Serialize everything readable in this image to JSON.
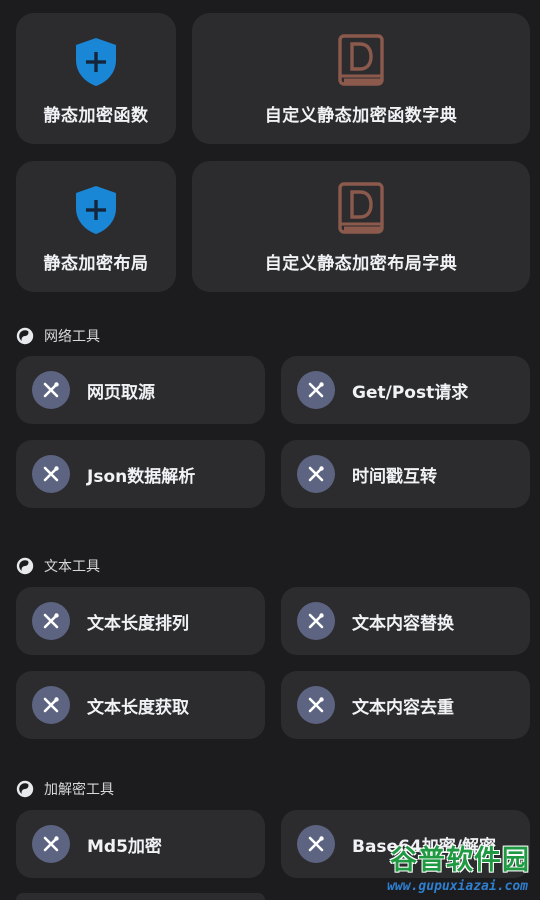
{
  "feature_cards": [
    {
      "label": "静态加密函数",
      "icon": "shield-plus-icon"
    },
    {
      "label": "自定义静态加密函数字典",
      "icon": "dictionary-book-icon"
    },
    {
      "label": "静态加密布局",
      "icon": "shield-plus-icon"
    },
    {
      "label": "自定义静态加密布局字典",
      "icon": "dictionary-book-icon"
    }
  ],
  "sections": [
    {
      "title": "网络工具",
      "tools": [
        {
          "label": "网页取源",
          "icon": "tools-icon"
        },
        {
          "label": "Get/Post请求",
          "icon": "tools-icon"
        },
        {
          "label": "Json数据解析",
          "icon": "tools-icon"
        },
        {
          "label": "时间戳互转",
          "icon": "tools-icon"
        }
      ]
    },
    {
      "title": "文本工具",
      "tools": [
        {
          "label": "文本长度排列",
          "icon": "tools-icon"
        },
        {
          "label": "文本内容替换",
          "icon": "tools-icon"
        },
        {
          "label": "文本长度获取",
          "icon": "tools-icon"
        },
        {
          "label": "文本内容去重",
          "icon": "tools-icon"
        }
      ]
    },
    {
      "title": "加解密工具",
      "tools": [
        {
          "label": "Md5加密",
          "icon": "tools-icon"
        },
        {
          "label": "Base64加密/解密",
          "icon": "tools-icon"
        }
      ]
    }
  ],
  "watermark": {
    "title": "谷普软件园",
    "url": "www.gupuxiazai.com"
  },
  "colors": {
    "background": "#1c1c1e",
    "card": "#2c2c2f",
    "shield_blue": "#1a86d6",
    "book_brown": "#8b5a4c",
    "tool_circle": "#5d6482"
  }
}
